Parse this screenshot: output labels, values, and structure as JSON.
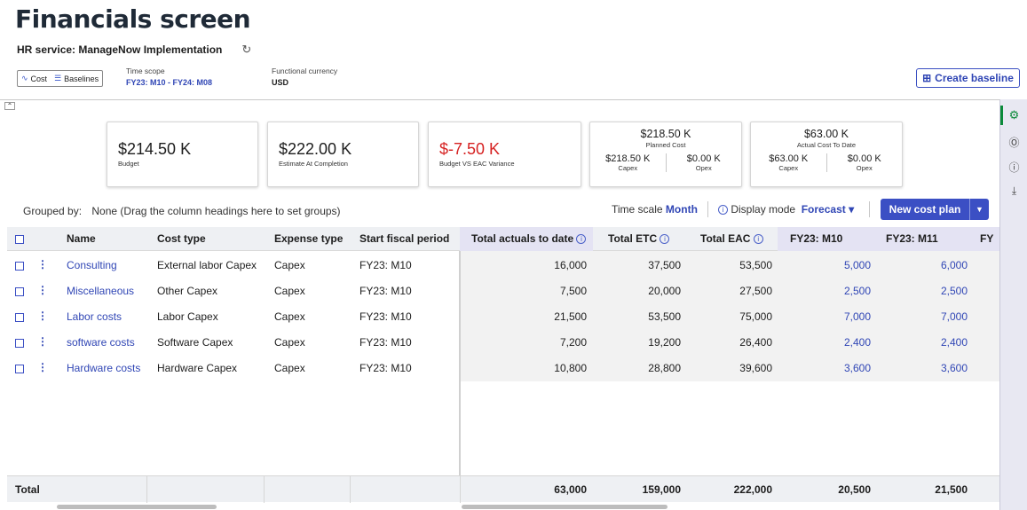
{
  "title": "Financials screen",
  "service": "HR service: ManageNow Implementation",
  "toggle": {
    "cost": "Cost",
    "baselines": "Baselines"
  },
  "time_scope": {
    "label": "Time scope",
    "value": "FY23: M10 - FY24: M08"
  },
  "currency": {
    "label": "Functional currency",
    "value": "USD"
  },
  "create_baseline": "Create baseline",
  "cards": {
    "budget": {
      "value": "$214.50 K",
      "label": "Budget"
    },
    "eac": {
      "value": "$222.00 K",
      "label": "Estimate At Completion"
    },
    "variance": {
      "value": "$-7.50 K",
      "label": "Budget VS EAC Variance"
    },
    "planned": {
      "value": "$218.50 K",
      "label": "Planned Cost",
      "capex": "$218.50 K",
      "capex_label": "Capex",
      "opex": "$0.00 K",
      "opex_label": "Opex"
    },
    "actual": {
      "value": "$63.00 K",
      "label": "Actual Cost To Date",
      "capex": "$63.00 K",
      "capex_label": "Capex",
      "opex": "$0.00 K",
      "opex_label": "Opex"
    }
  },
  "grouped_by": {
    "label": "Grouped by:",
    "value": "None (Drag the column headings here to set groups)"
  },
  "time_scale": {
    "label": "Time scale",
    "value": "Month"
  },
  "display_mode": {
    "label": "Display mode",
    "value": "Forecast"
  },
  "new_cost_plan": "New cost plan",
  "columns": {
    "name": "Name",
    "cost_type": "Cost type",
    "expense_type": "Expense type",
    "start": "Start fiscal period",
    "actuals": "Total actuals to date",
    "etc": "Total ETC",
    "eac": "Total EAC",
    "m10": "FY23: M10",
    "m11": "FY23: M11",
    "m12": "FY"
  },
  "rows": [
    {
      "name": "Consulting",
      "cost_type": "External labor Capex",
      "expense_type": "Capex",
      "start": "FY23: M10",
      "actuals": "16,000",
      "etc": "37,500",
      "eac": "53,500",
      "m10": "5,000",
      "m11": "6,000"
    },
    {
      "name": "Miscellaneous",
      "cost_type": "Other Capex",
      "expense_type": "Capex",
      "start": "FY23: M10",
      "actuals": "7,500",
      "etc": "20,000",
      "eac": "27,500",
      "m10": "2,500",
      "m11": "2,500"
    },
    {
      "name": "Labor costs",
      "cost_type": "Labor Capex",
      "expense_type": "Capex",
      "start": "FY23: M10",
      "actuals": "21,500",
      "etc": "53,500",
      "eac": "75,000",
      "m10": "7,000",
      "m11": "7,000"
    },
    {
      "name": "software costs",
      "cost_type": "Software Capex",
      "expense_type": "Capex",
      "start": "FY23: M10",
      "actuals": "7,200",
      "etc": "19,200",
      "eac": "26,400",
      "m10": "2,400",
      "m11": "2,400"
    },
    {
      "name": "Hardware costs",
      "cost_type": "Hardware Capex",
      "expense_type": "Capex",
      "start": "FY23: M10",
      "actuals": "10,800",
      "etc": "28,800",
      "eac": "39,600",
      "m10": "3,600",
      "m11": "3,600"
    }
  ],
  "totals": {
    "label": "Total",
    "actuals": "63,000",
    "etc": "159,000",
    "eac": "222,000",
    "m10": "20,500",
    "m11": "21,500"
  },
  "icons": {
    "refresh": "refresh-icon",
    "settings": "gear-icon",
    "help": "help-icon",
    "info": "info-icon",
    "download": "download-icon"
  }
}
